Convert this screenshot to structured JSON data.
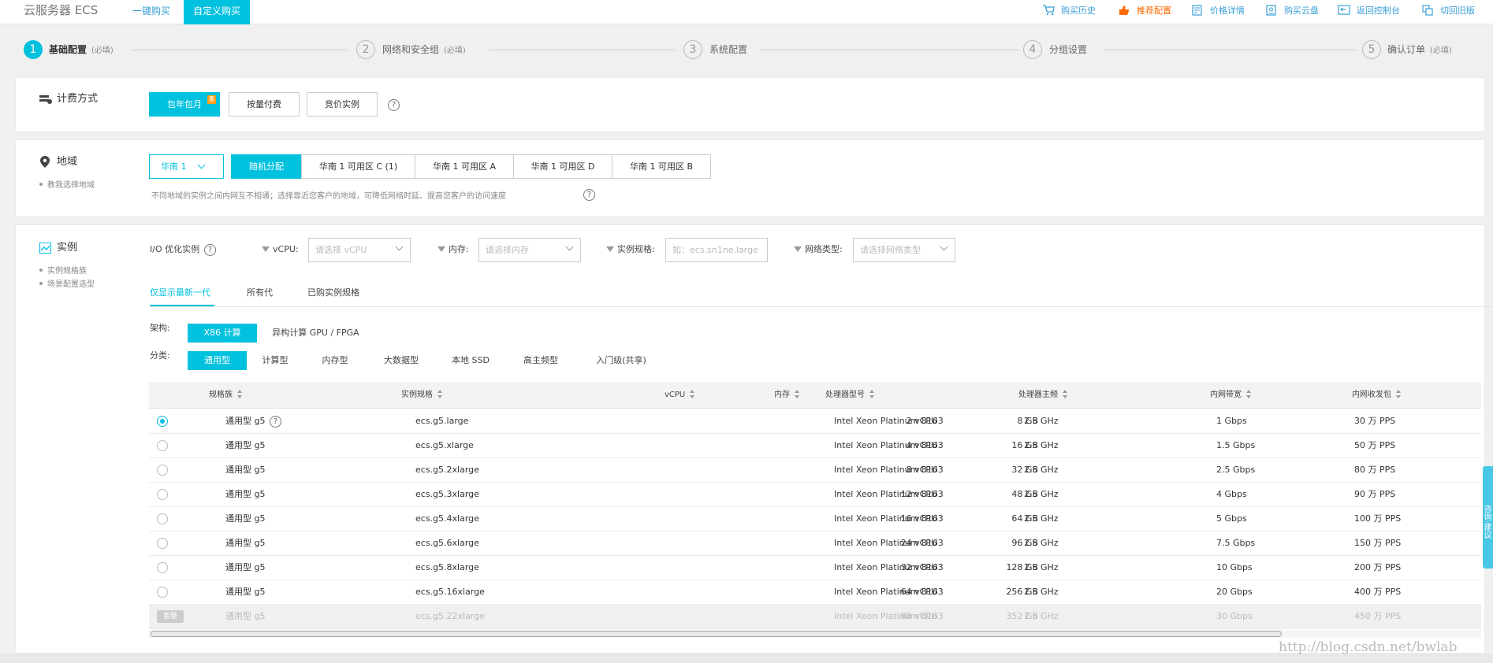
{
  "header": {
    "brand": "云服务器 ECS",
    "tabs": [
      "一键购买",
      "自定义购买"
    ],
    "links": [
      "购买历史",
      "推荐配置",
      "价格详情",
      "购买云盘",
      "返回控制台",
      "切回旧版"
    ]
  },
  "steps": [
    {
      "num": "1",
      "label": "基础配置",
      "note": "(必填)"
    },
    {
      "num": "2",
      "label": "网络和安全组",
      "note": "(必填)"
    },
    {
      "num": "3",
      "label": "系统配置",
      "note": ""
    },
    {
      "num": "4",
      "label": "分组设置",
      "note": ""
    },
    {
      "num": "5",
      "label": "确认订单",
      "note": "(必填)"
    }
  ],
  "billing": {
    "title": "计费方式",
    "options": [
      "包年包月",
      "按量付费",
      "竞价实例"
    ],
    "selected_badge": "惠",
    "help": "?"
  },
  "region": {
    "title": "地域",
    "sub": "教我选择地域",
    "region_select": "华南 1",
    "zones": [
      "随机分配",
      "华南 1 可用区 C (1)",
      "华南 1 可用区 A",
      "华南 1 可用区 D",
      "华南 1 可用区 B"
    ],
    "note": "不同地域的实例之间内网互不相通；选择靠近您客户的地域，可降低网络时延、提高您客户的访问速度",
    "help": "?"
  },
  "instance": {
    "title": "实例",
    "subs": [
      "实例规格族",
      "场景配置选型"
    ],
    "filters": {
      "io_label": "I/O 优化实例",
      "help": "?",
      "vcpu_label": "vCPU:",
      "vcpu_placeholder": "请选择 vCPU",
      "mem_label": "内存:",
      "mem_placeholder": "请选择内存",
      "spec_label": "实例规格:",
      "spec_placeholder": "如：ecs.sn1ne.large",
      "net_label": "网络类型:",
      "net_placeholder": "请选择网络类型"
    },
    "gen_tabs": [
      "仅显示最新一代",
      "所有代",
      "已购实例规格"
    ],
    "arch_label": "架构:",
    "arch_options": [
      "X86 计算",
      "异构计算 GPU / FPGA"
    ],
    "cat_label": "分类:",
    "categories": [
      "通用型",
      "计算型",
      "内存型",
      "大数据型",
      "本地 SSD",
      "高主频型",
      "入门级(共享)"
    ],
    "table": {
      "columns": [
        "规格族",
        "实例规格",
        "vCPU",
        "内存",
        "处理器型号",
        "处理器主频",
        "内网带宽",
        "内网收发包"
      ],
      "rows": [
        {
          "family": "通用型 g5",
          "spec": "ecs.g5.large",
          "vcpu": "2 vCPU",
          "mem": "8 GB",
          "cpu": "Intel Xeon Platinum 8163",
          "freq": "2.5 GHz",
          "bw": "1 Gbps",
          "pps": "30 万 PPS",
          "state": "selected"
        },
        {
          "family": "通用型 g5",
          "spec": "ecs.g5.xlarge",
          "vcpu": "4 vCPU",
          "mem": "16 GB",
          "cpu": "Intel Xeon Platinum 8163",
          "freq": "2.5 GHz",
          "bw": "1.5 Gbps",
          "pps": "50 万 PPS",
          "state": "normal"
        },
        {
          "family": "通用型 g5",
          "spec": "ecs.g5.2xlarge",
          "vcpu": "8 vCPU",
          "mem": "32 GB",
          "cpu": "Intel Xeon Platinum 8163",
          "freq": "2.5 GHz",
          "bw": "2.5 Gbps",
          "pps": "80 万 PPS",
          "state": "normal"
        },
        {
          "family": "通用型 g5",
          "spec": "ecs.g5.3xlarge",
          "vcpu": "12 vCPU",
          "mem": "48 GB",
          "cpu": "Intel Xeon Platinum 8163",
          "freq": "2.5 GHz",
          "bw": "4 Gbps",
          "pps": "90 万 PPS",
          "state": "normal"
        },
        {
          "family": "通用型 g5",
          "spec": "ecs.g5.4xlarge",
          "vcpu": "16 vCPU",
          "mem": "64 GB",
          "cpu": "Intel Xeon Platinum 8163",
          "freq": "2.5 GHz",
          "bw": "5 Gbps",
          "pps": "100 万 PPS",
          "state": "normal"
        },
        {
          "family": "通用型 g5",
          "spec": "ecs.g5.6xlarge",
          "vcpu": "24 vCPU",
          "mem": "96 GB",
          "cpu": "Intel Xeon Platinum 8163",
          "freq": "2.5 GHz",
          "bw": "7.5 Gbps",
          "pps": "150 万 PPS",
          "state": "normal"
        },
        {
          "family": "通用型 g5",
          "spec": "ecs.g5.8xlarge",
          "vcpu": "32 vCPU",
          "mem": "128 GB",
          "cpu": "Intel Xeon Platinum 8163",
          "freq": "2.5 GHz",
          "bw": "10 Gbps",
          "pps": "200 万 PPS",
          "state": "normal"
        },
        {
          "family": "通用型 g5",
          "spec": "ecs.g5.16xlarge",
          "vcpu": "64 vCPU",
          "mem": "256 GB",
          "cpu": "Intel Xeon Platinum 8163",
          "freq": "2.5 GHz",
          "bw": "20 Gbps",
          "pps": "400 万 PPS",
          "state": "normal"
        },
        {
          "family": "通用型 g5",
          "spec": "ecs.g5.22xlarge",
          "vcpu": "88 vCPU",
          "mem": "352 GB",
          "cpu": "Intel Xeon Platinum 8163",
          "freq": "2.5 GHz",
          "bw": "30 Gbps",
          "pps": "450 万 PPS",
          "state": "disabled",
          "badge": "售罄"
        }
      ]
    }
  },
  "feedback_tab": "咨询·建议",
  "watermark": "http://blog.csdn.net/bwlab",
  "colors": {
    "accent": "#00c1de",
    "link": "#3a9fd6",
    "orange": "#ff6a00"
  }
}
